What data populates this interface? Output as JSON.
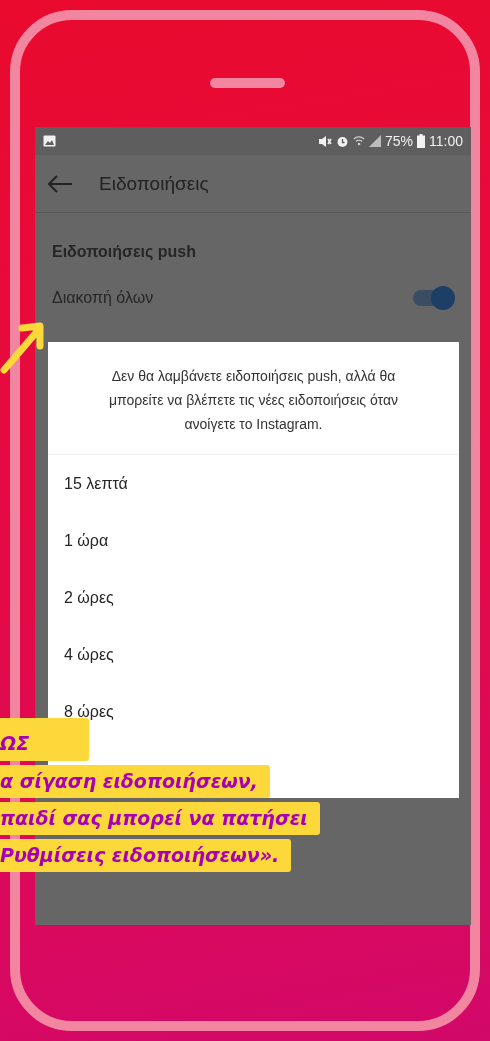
{
  "status_bar": {
    "battery": "75%",
    "time": "11:00"
  },
  "app_bar": {
    "title": "Ειδοποιήσεις"
  },
  "section": {
    "title": "Ειδοποιήσεις push"
  },
  "setting": {
    "label": "Διακοπή όλων",
    "on": true
  },
  "dialog": {
    "message": "Δεν θα λαμβάνετε ειδοποιήσεις push, αλλά θα μπορείτε να βλέπετε τις νέες ειδοποιήσεις όταν ανοίγετε το Instagram.",
    "options": [
      {
        "label": "15 λεπτά"
      },
      {
        "label": "1 ώρα"
      },
      {
        "label": "2 ώρες"
      },
      {
        "label": "4 ώρες"
      },
      {
        "label": "8 ώρες"
      }
    ]
  },
  "caption": {
    "lines": [
      "ΩΣ",
      "α σίγαση ειδοποιήσεων,",
      "παιδί σας μπορεί να πατήσει",
      "Ρυθμίσεις ειδοποιήσεων»."
    ]
  }
}
